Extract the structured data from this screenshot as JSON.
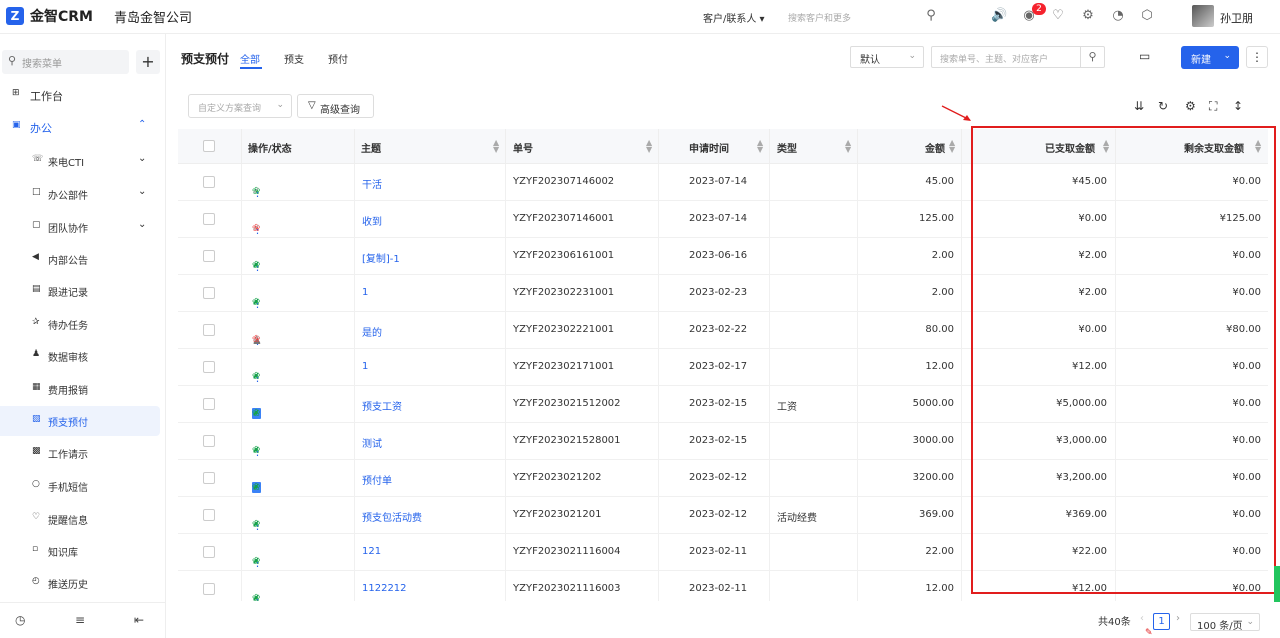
{
  "app": {
    "logo_text": "金智CRM",
    "company": "青岛金智公司",
    "user": "孙卫朋",
    "notification_count": "2"
  },
  "global_search": {
    "type_label": "客户/联系人 ▾",
    "placeholder": "搜索客户和更多"
  },
  "sidebar": {
    "search_placeholder": "搜索菜单",
    "items": [
      {
        "label": "工作台",
        "icon": "dashboard-icon",
        "level": "top"
      },
      {
        "label": "办公",
        "icon": "briefcase-icon",
        "level": "top",
        "expanded": true
      },
      {
        "label": "来电CTI",
        "icon": "phone-icon",
        "expandable": true
      },
      {
        "label": "办公部件",
        "icon": "widget-icon",
        "expandable": true
      },
      {
        "label": "团队协作",
        "icon": "team-icon",
        "expandable": true
      },
      {
        "label": "内部公告",
        "icon": "megaphone-icon"
      },
      {
        "label": "跟进记录",
        "icon": "record-icon"
      },
      {
        "label": "待办任务",
        "icon": "pin-icon"
      },
      {
        "label": "数据审核",
        "icon": "user-check-icon"
      },
      {
        "label": "费用报销",
        "icon": "receipt-icon"
      },
      {
        "label": "预支预付",
        "icon": "prepay-icon",
        "active": true
      },
      {
        "label": "工作请示",
        "icon": "request-icon"
      },
      {
        "label": "手机短信",
        "icon": "sms-icon"
      },
      {
        "label": "提醒信息",
        "icon": "bell-icon"
      },
      {
        "label": "知识库",
        "icon": "book-icon"
      },
      {
        "label": "推送历史",
        "icon": "history-icon"
      }
    ]
  },
  "page": {
    "title": "预支预付",
    "tabs": [
      "全部",
      "预支",
      "预付"
    ],
    "active_tab": "全部",
    "view_select": "默认",
    "search_placeholder": "搜索单号、主题、对应客户",
    "new_button": "新建",
    "custom_query_placeholder": "自定义方案查询",
    "advanced_query": "高级查询"
  },
  "table": {
    "columns": [
      "操作/状态",
      "主题",
      "单号",
      "申请时间",
      "类型",
      "金额",
      "已支取金额",
      "剩余支取金额"
    ],
    "rows": [
      {
        "subject": "干活",
        "number": "YZYF202307146002",
        "date": "2023-07-14",
        "type": "",
        "amount": "45.00",
        "paid": "¥45.00",
        "remaining": "¥0.00",
        "hand": "green",
        "check": "gray",
        "doc": false,
        "person": false
      },
      {
        "subject": "收到",
        "number": "YZYF202307146001",
        "date": "2023-07-14",
        "type": "",
        "amount": "125.00",
        "paid": "¥0.00",
        "remaining": "¥125.00",
        "hand": "red",
        "check": "gray",
        "doc": false,
        "person": false
      },
      {
        "subject": "[复制]-1",
        "number": "YZYF202306161001",
        "date": "2023-06-16",
        "type": "",
        "amount": "2.00",
        "paid": "¥2.00",
        "remaining": "¥0.00",
        "hand": "green",
        "check": "green",
        "doc": false,
        "person": false
      },
      {
        "subject": "1",
        "number": "YZYF202302231001",
        "date": "2023-02-23",
        "type": "",
        "amount": "2.00",
        "paid": "¥2.00",
        "remaining": "¥0.00",
        "hand": "green",
        "check": "green",
        "doc": false,
        "person": false
      },
      {
        "subject": "是的",
        "number": "YZYF202302221001",
        "date": "2023-02-22",
        "type": "",
        "amount": "80.00",
        "paid": "¥0.00",
        "remaining": "¥80.00",
        "hand": "red",
        "check": "gray",
        "doc": false,
        "person": true
      },
      {
        "subject": "1",
        "number": "YZYF202302171001",
        "date": "2023-02-17",
        "type": "",
        "amount": "12.00",
        "paid": "¥12.00",
        "remaining": "¥0.00",
        "hand": "green",
        "check": "green",
        "doc": false,
        "person": false
      },
      {
        "subject": "预支工资",
        "number": "YZYF2023021512002",
        "date": "2023-02-15",
        "type": "工资",
        "amount": "5000.00",
        "paid": "¥5,000.00",
        "remaining": "¥0.00",
        "hand": "green",
        "check": "green",
        "doc": true,
        "person": false
      },
      {
        "subject": "测试",
        "number": "YZYF2023021528001",
        "date": "2023-02-15",
        "type": "",
        "amount": "3000.00",
        "paid": "¥3,000.00",
        "remaining": "¥0.00",
        "hand": "green",
        "check": "green",
        "doc": false,
        "person": false
      },
      {
        "subject": "预付单",
        "number": "YZYF2023021202",
        "date": "2023-02-12",
        "type": "",
        "amount": "3200.00",
        "paid": "¥3,200.00",
        "remaining": "¥0.00",
        "hand": "green",
        "check": "green",
        "doc": true,
        "person": false
      },
      {
        "subject": "预支包活动费",
        "number": "YZYF2023021201",
        "date": "2023-02-12",
        "type": "活动经费",
        "amount": "369.00",
        "paid": "¥369.00",
        "remaining": "¥0.00",
        "hand": "green",
        "check": "green",
        "doc": false,
        "person": false
      },
      {
        "subject": "121",
        "number": "YZYF2023021116004",
        "date": "2023-02-11",
        "type": "",
        "amount": "22.00",
        "paid": "¥22.00",
        "remaining": "¥0.00",
        "hand": "green",
        "check": "green",
        "doc": false,
        "person": false
      },
      {
        "subject": "1122212",
        "number": "YZYF2023021116003",
        "date": "2023-02-11",
        "type": "",
        "amount": "12.00",
        "paid": "¥12.00",
        "remaining": "¥0.00",
        "hand": "green",
        "check": "green",
        "doc": false,
        "person": false
      }
    ]
  },
  "pagination": {
    "total": "共40条",
    "current_page": "1",
    "page_size": "100 条/页"
  },
  "colors": {
    "primary": "#2563eb",
    "annotation_red": "#e11d1d",
    "ok_green": "#16a34a"
  }
}
